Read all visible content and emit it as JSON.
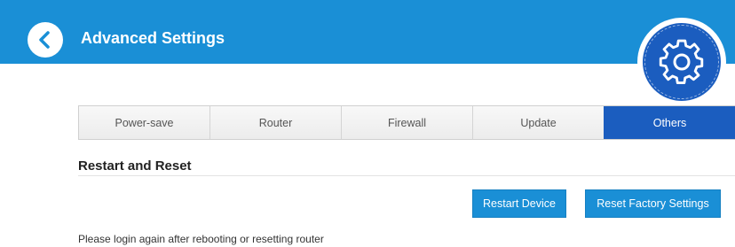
{
  "header": {
    "title": "Advanced Settings",
    "back_icon": "chevron-left-icon",
    "settings_icon": "gear-icon",
    "bar_color": "#1a8fd6",
    "accent_color": "#1b5dbf"
  },
  "tabs": [
    {
      "label": "Power-save",
      "active": false
    },
    {
      "label": "Router",
      "active": false
    },
    {
      "label": "Firewall",
      "active": false
    },
    {
      "label": "Update",
      "active": false
    },
    {
      "label": "Others",
      "active": true
    }
  ],
  "section": {
    "title": "Restart and Reset",
    "restart_button": "Restart Device",
    "reset_button": "Reset Factory Settings",
    "note": "Please login again after rebooting or resetting router"
  }
}
